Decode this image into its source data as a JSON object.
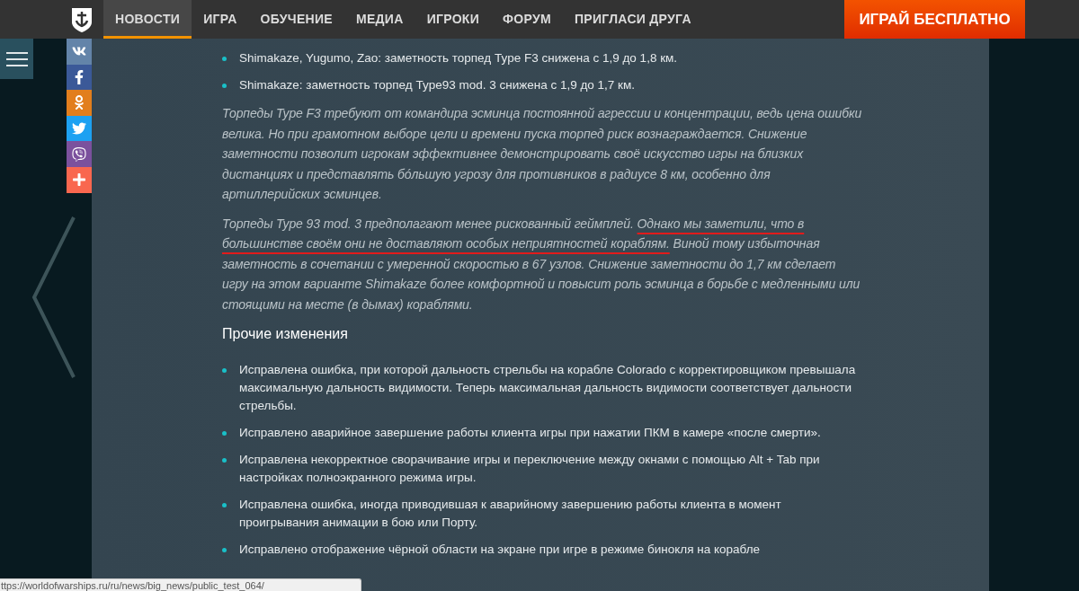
{
  "nav": {
    "items": [
      {
        "label": "НОВОСТИ",
        "selected": true
      },
      {
        "label": "ИГРА",
        "selected": false
      },
      {
        "label": "ОБУЧЕНИЕ",
        "selected": false
      },
      {
        "label": "МЕДИА",
        "selected": false
      },
      {
        "label": "ИГРОКИ",
        "selected": false
      },
      {
        "label": "ФОРУМ",
        "selected": false
      },
      {
        "label": "ПРИГЛАСИ ДРУГА",
        "selected": false
      }
    ],
    "cta": "ИГРАЙ БЕСПЛАТНО"
  },
  "share": [
    {
      "kind": "vk",
      "color": "#6384a9"
    },
    {
      "kind": "facebook",
      "color": "#3b5998"
    },
    {
      "kind": "odnoklassniki",
      "color": "#e27e1d"
    },
    {
      "kind": "twitter",
      "color": "#1da1f2"
    },
    {
      "kind": "viber",
      "color": "#7b519d"
    },
    {
      "kind": "more",
      "color": "#f9674f"
    }
  ],
  "article": [
    {
      "kind": "bullets",
      "items": [
        "Shimakaze, Yugumo, Zao: заметность торпед Type F3 снижена с 1,9 до 1,8 км.",
        "Shimakaze: заметность торпед Type93 mod. 3 снижена с 1,9 до 1,7 км."
      ]
    },
    {
      "kind": "note",
      "lead": "Торпеды Type F3 требуют от командира эсминца постоянной агрессии и концентрации, ведь цена ошибки велика. Но при грамотном выборе цели и времени пуска торпед риск вознаграждается. Снижение заметности позволит игрокам эффективнее демонстрировать своё искусство игры на близких дистанциях и представлять бóльшую угрозу для противников в радиусе 8 км, особенно для артиллерийских эсминцев."
    },
    {
      "kind": "note",
      "lead": "Торпеды Type 93 mod. 3 предполагают менее рискованный геймплей. ",
      "underlined": "Однако мы заметили, что в большинстве своём они не доставляют особых неприятностей кораблям.",
      "tail": " Виной тому избыточная заметность в сочетании с умеренной скоростью в 67 узлов. Снижение заметности до 1,7 км сделает игру на этом варианте Shimakaze более комфортной и повысит роль эсминца в борьбе с медленными или стоящими на месте (в дымах) кораблями."
    },
    {
      "kind": "heading",
      "text": "Прочие изменения"
    },
    {
      "kind": "bullets",
      "items": [
        "Исправлена ошибка, при которой дальность стрельбы на корабле Colorado с корректировщиком превышала максимальную дальность видимости. Теперь максимальная дальность видимости соответствует дальности стрельбы.",
        "Исправлено аварийное завершение работы клиента игры при нажатии ПКМ в камере «после смерти».",
        "Исправлена некорректное сворачивание игры и переключение между окнами с помощью Alt + Tab при настройках полноэкранного режима игры.",
        "Исправлена ошибка, иногда приводившая к аварийному завершению работы клиента в момент проигрывания анимации в бою или Порту.",
        "Исправлено отображение чёрной области на экране при игре в режиме бинокля на корабле"
      ]
    }
  ],
  "status_bar": {
    "url": "ttps://worldofwarships.ru/ru/news/big_news/public_test_064/"
  }
}
